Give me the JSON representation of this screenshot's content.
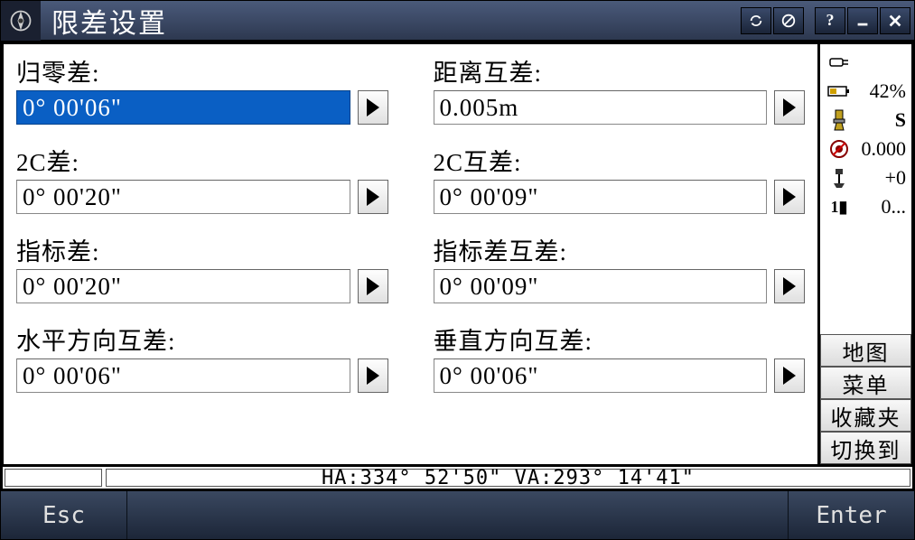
{
  "title": "限差设置",
  "fields": {
    "left": [
      {
        "label": "归零差:",
        "value": "0° 00'06\"",
        "selected": true
      },
      {
        "label": "2C差:",
        "value": "0° 00'20\"",
        "selected": false
      },
      {
        "label": "指标差:",
        "value": "0° 00'20\"",
        "selected": false
      },
      {
        "label": "水平方向互差:",
        "value": "0° 00'06\"",
        "selected": false
      }
    ],
    "right": [
      {
        "label": "距离互差:",
        "value": "0.005m",
        "selected": false
      },
      {
        "label": "2C互差:",
        "value": "0° 00'09\"",
        "selected": false
      },
      {
        "label": "指标差互差:",
        "value": "0° 00'09\"",
        "selected": false
      },
      {
        "label": "垂直方向互差:",
        "value": "0° 00'06\"",
        "selected": false
      }
    ]
  },
  "sidebar": {
    "battery": "42%",
    "mode": "S",
    "dist": "0.000",
    "offset": "+0",
    "count": "0...",
    "buttons": [
      "地图",
      "菜单",
      "收藏夹",
      "切换到"
    ]
  },
  "statusbar": "HA:334° 52'50\"  VA:293° 14'41\"",
  "bottom": {
    "left": "Esc",
    "right": "Enter"
  }
}
